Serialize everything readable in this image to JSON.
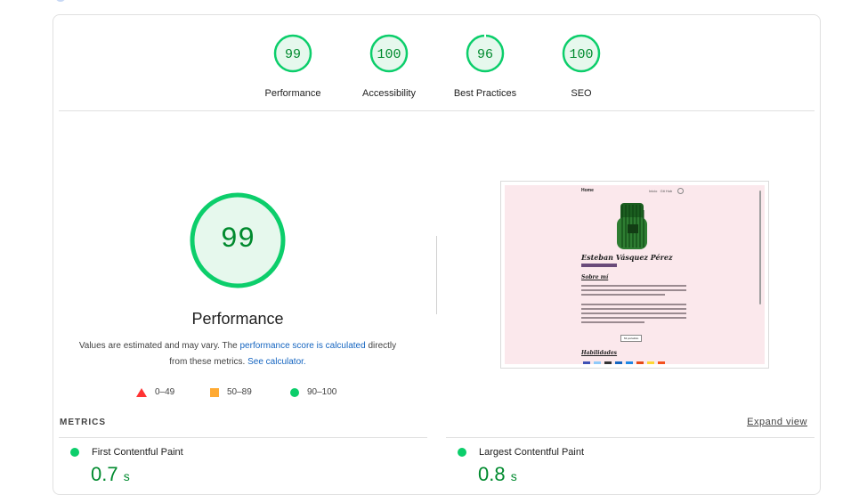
{
  "summary": {
    "gauges": [
      {
        "score": "99",
        "label": "Performance"
      },
      {
        "score": "100",
        "label": "Accessibility"
      },
      {
        "score": "96",
        "label": "Best Practices"
      },
      {
        "score": "100",
        "label": "SEO"
      }
    ]
  },
  "performance": {
    "score": "99",
    "title": "Performance",
    "desc_prefix": "Values are estimated and may vary. The ",
    "desc_link": "performance score is calculated",
    "desc_middle": " directly from these metrics. ",
    "calc_link": "See calculator.",
    "legend": {
      "fail": "0–49",
      "average": "50–89",
      "pass": "90–100"
    }
  },
  "screenshot_preview": {
    "nav_brand": "Home",
    "nav_links": "Inicio   Git Hub",
    "name": "Esteban Vásquez Pérez",
    "section1": "Sobre mí",
    "section2": "Habilidades",
    "button": "Mi portafolio"
  },
  "metrics": {
    "header": "METRICS",
    "expand": "Expand view",
    "fcp_label": "First Contentful Paint",
    "fcp_value": "0.7",
    "fcp_unit": "s",
    "lcp_label": "Largest Contentful Paint",
    "lcp_value": "0.8",
    "lcp_unit": "s"
  },
  "colors": {
    "pass": "#0cce6b",
    "average": "#ffaa33",
    "fail": "#ff3333",
    "pass_text": "#008a2e",
    "link": "#1565c0"
  }
}
